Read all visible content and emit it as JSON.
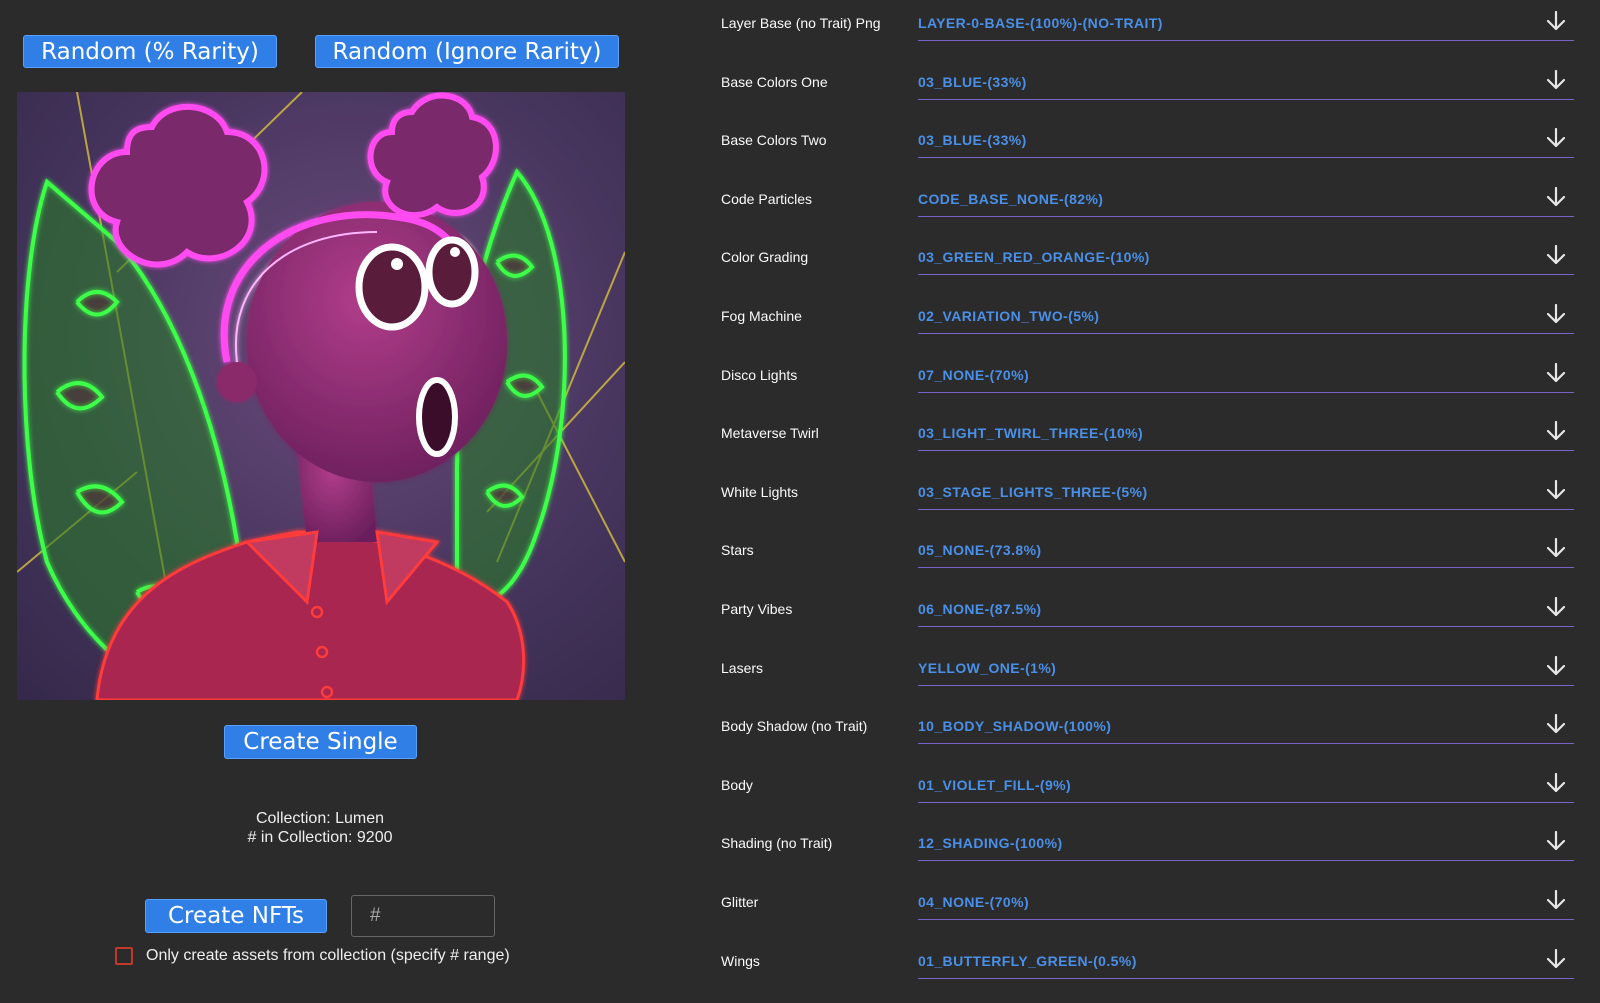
{
  "buttons": {
    "random_rarity": "Random (% Rarity)",
    "random_ignore": "Random (Ignore Rarity)",
    "create_single": "Create Single",
    "create_nfts": "Create NFTs"
  },
  "collection": {
    "name_line": "Collection: Lumen",
    "count_line": "# in Collection: 9200"
  },
  "count_input": {
    "placeholder": "#",
    "value": ""
  },
  "checkbox": {
    "label": "Only create assets from collection (specify # range)",
    "checked": false
  },
  "preview": {
    "alt": "NFT preview",
    "icon": "nft-preview-image"
  },
  "layers": [
    {
      "name": "Layer Base (no Trait) Png",
      "value": "LAYER-0-BASE-(100%)-(NO-TRAIT)"
    },
    {
      "name": "Base Colors One",
      "value": "03_BLUE-(33%)"
    },
    {
      "name": "Base Colors Two",
      "value": "03_BLUE-(33%)"
    },
    {
      "name": "Code Particles",
      "value": "CODE_BASE_NONE-(82%)"
    },
    {
      "name": "Color Grading",
      "value": "03_GREEN_RED_ORANGE-(10%)"
    },
    {
      "name": "Fog Machine",
      "value": "02_VARIATION_TWO-(5%)"
    },
    {
      "name": "Disco Lights",
      "value": "07_NONE-(70%)"
    },
    {
      "name": "Metaverse Twirl",
      "value": "03_LIGHT_TWIRL_THREE-(10%)"
    },
    {
      "name": "White Lights",
      "value": "03_STAGE_LIGHTS_THREE-(5%)"
    },
    {
      "name": "Stars",
      "value": "05_NONE-(73.8%)"
    },
    {
      "name": "Party Vibes",
      "value": "06_NONE-(87.5%)"
    },
    {
      "name": "Lasers",
      "value": "YELLOW_ONE-(1%)"
    },
    {
      "name": "Body Shadow (no Trait)",
      "value": "10_BODY_SHADOW-(100%)"
    },
    {
      "name": "Body",
      "value": "01_VIOLET_FILL-(9%)"
    },
    {
      "name": "Shading (no Trait)",
      "value": "12_SHADING-(100%)"
    },
    {
      "name": "Glitter",
      "value": "04_NONE-(70%)"
    },
    {
      "name": "Wings",
      "value": "01_BUTTERFLY_GREEN-(0.5%)"
    }
  ],
  "colors": {
    "background": "#2b2b2b",
    "button": "#2f7fe6",
    "layer_value": "#4a90e8",
    "underline": "#7a63c8",
    "checkbox_border": "#c0392b"
  }
}
